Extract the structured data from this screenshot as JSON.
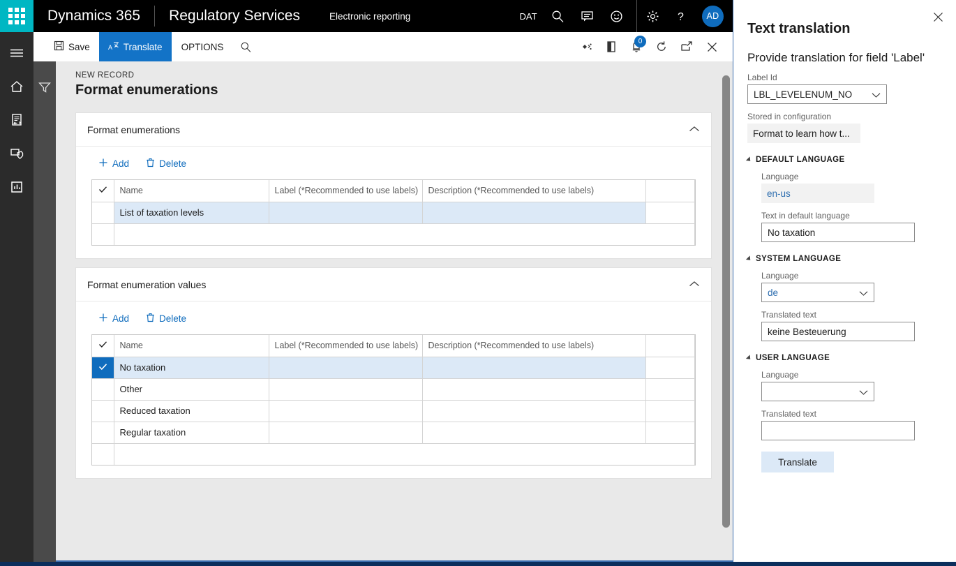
{
  "topnav": {
    "waffle_icon": "waffle-grid-icon",
    "brand": "Dynamics 365",
    "module": "Regulatory Services",
    "page_context": "Electronic reporting",
    "company": "DAT",
    "search_icon": "search-icon",
    "feedback_icon": "feedback-chat-icon",
    "smiley_icon": "smiley-face-icon",
    "settings_icon": "gear-icon",
    "help_icon": "question-mark-help-icon",
    "avatar_initials": "AD"
  },
  "rail": {
    "menu_icon": "hamburger-menu-icon",
    "home_icon": "home-icon",
    "workspace_icon": "document-transfer-icon",
    "security_icon": "shield-monitor-icon",
    "reports_icon": "report-board-icon",
    "filter_icon": "funnel-filter-icon"
  },
  "actionpane": {
    "save_label": "Save",
    "save_icon": "save-disk-icon",
    "translate_label": "Translate",
    "translate_icon": "translate-a-icon",
    "options_label": "OPTIONS",
    "search_icon": "search-icon",
    "share_icon": "share-diamond-icon",
    "office_icon": "office-open-icon",
    "notifications_icon": "notification-bell-icon",
    "notifications_count": "0",
    "refresh_icon": "refresh-circle-icon",
    "popout_icon": "popout-window-icon",
    "close_icon": "close-x-icon"
  },
  "page": {
    "breadcrumb": "NEW RECORD",
    "title": "Format enumerations"
  },
  "sections": [
    {
      "title": "Format enumerations",
      "collapse_icon": "chevron-up-icon",
      "toolbar": {
        "add_label": "Add",
        "add_icon": "plus-icon",
        "delete_label": "Delete",
        "delete_icon": "trash-can-icon"
      },
      "columns": [
        "Name",
        "Label (*Recommended to use labels)",
        "Description (*Recommended to use labels)"
      ],
      "header_check_icon": "checkmark-icon",
      "rows": [
        {
          "name": "List of taxation levels",
          "label": "",
          "description": "",
          "selected": true,
          "checked": false
        }
      ]
    },
    {
      "title": "Format enumeration values",
      "collapse_icon": "chevron-up-icon",
      "toolbar": {
        "add_label": "Add",
        "add_icon": "plus-icon",
        "delete_label": "Delete",
        "delete_icon": "trash-can-icon"
      },
      "columns": [
        "Name",
        "Label (*Recommended to use labels)",
        "Description (*Recommended to use labels)"
      ],
      "header_check_icon": "checkmark-icon",
      "rows": [
        {
          "name": "No taxation",
          "label": "",
          "description": "",
          "selected": true,
          "checked": true
        },
        {
          "name": "Other",
          "label": "",
          "description": "",
          "selected": false,
          "checked": false
        },
        {
          "name": "Reduced taxation",
          "label": "",
          "description": "",
          "selected": false,
          "checked": false
        },
        {
          "name": "Regular taxation",
          "label": "",
          "description": "",
          "selected": false,
          "checked": false
        }
      ]
    }
  ],
  "panel": {
    "close_icon": "close-x-icon",
    "title": "Text translation",
    "subtitle": "Provide translation for field 'Label'",
    "label_id": {
      "label": "Label Id",
      "value": "LBL_LEVELENUM_NO",
      "caret_icon": "chevron-down-icon"
    },
    "stored_in_configuration": {
      "label": "Stored in configuration",
      "value": "Format to learn how t..."
    },
    "default_language": {
      "section_title": "DEFAULT LANGUAGE",
      "expand_icon": "triangle-expanded-icon",
      "language_label": "Language",
      "language_value": "en-us",
      "text_label": "Text in default language",
      "text_value": "No taxation"
    },
    "system_language": {
      "section_title": "SYSTEM LANGUAGE",
      "expand_icon": "triangle-expanded-icon",
      "language_label": "Language",
      "language_value": "de",
      "caret_icon": "chevron-down-icon",
      "text_label": "Translated text",
      "text_value": "keine Besteuerung"
    },
    "user_language": {
      "section_title": "USER LANGUAGE",
      "expand_icon": "triangle-expanded-icon",
      "language_label": "Language",
      "language_value": "",
      "caret_icon": "chevron-down-icon",
      "text_label": "Translated text",
      "text_value": ""
    },
    "translate_button": "Translate"
  },
  "colors": {
    "waffle_teal": "#00b7c3",
    "accent_blue": "#0f6cbd",
    "active_tab_blue": "#1373c7",
    "selected_row": "#dce9f7",
    "panel_border": "#3c6fb0",
    "bottom_strip": "#0b2e5c"
  }
}
